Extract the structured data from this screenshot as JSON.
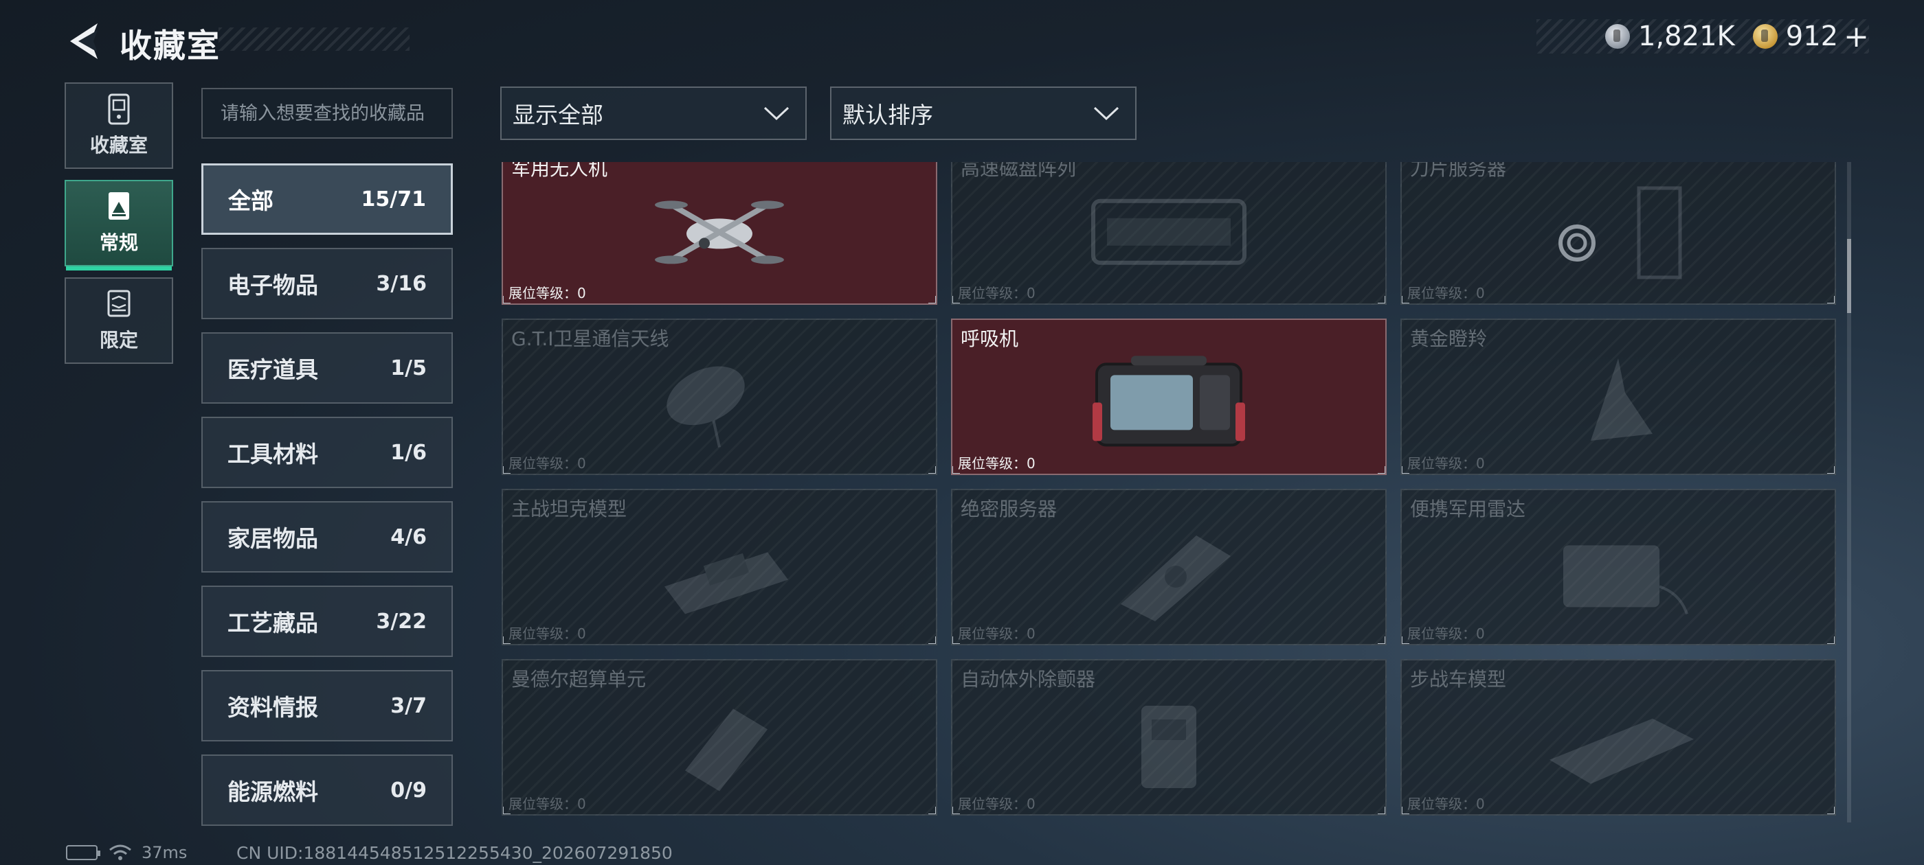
{
  "header": {
    "title": "收藏室",
    "currencies": [
      {
        "icon": "silver-coin-icon",
        "value": "1,821K"
      },
      {
        "icon": "gold-coin-icon",
        "value": "912"
      }
    ],
    "plus_label": "+"
  },
  "rail": [
    {
      "label": "收藏室",
      "icon": "cabinet-icon",
      "active": false
    },
    {
      "label": "常规",
      "icon": "image-card-icon",
      "active": true
    },
    {
      "label": "限定",
      "icon": "limited-card-icon",
      "active": false
    }
  ],
  "search": {
    "placeholder": "请输入想要查找的收藏品"
  },
  "filters": {
    "display": "显示全部",
    "sort": "默认排序"
  },
  "categories": [
    {
      "name": "全部",
      "count": "15/71",
      "active": true
    },
    {
      "name": "电子物品",
      "count": "3/16"
    },
    {
      "name": "医疗道具",
      "count": "1/5"
    },
    {
      "name": "工具材料",
      "count": "1/6"
    },
    {
      "name": "家居物品",
      "count": "4/6"
    },
    {
      "name": "工艺藏品",
      "count": "3/22"
    },
    {
      "name": "资料情报",
      "count": "3/7"
    },
    {
      "name": "能源燃料",
      "count": "0/9"
    }
  ],
  "items": [
    {
      "name": "军用无人机",
      "level": "展位等级：0",
      "owned": true,
      "icon": "drone-icon"
    },
    {
      "name": "高速磁盘阵列",
      "level": "展位等级：0",
      "owned": false,
      "icon": "disk-array-icon"
    },
    {
      "name": "刀片服务器",
      "level": "展位等级：0",
      "owned": false,
      "icon": "blade-server-icon"
    },
    {
      "name": "G.T.I卫星通信天线",
      "level": "展位等级：0",
      "owned": false,
      "icon": "satellite-dish-icon"
    },
    {
      "name": "呼吸机",
      "level": "展位等级：0",
      "owned": true,
      "icon": "ventilator-icon"
    },
    {
      "name": "黄金瞪羚",
      "level": "展位等级：0",
      "owned": false,
      "icon": "gazelle-statue-icon"
    },
    {
      "name": "主战坦克模型",
      "level": "展位等级：0",
      "owned": false,
      "icon": "tank-model-icon"
    },
    {
      "name": "绝密服务器",
      "level": "展位等级：0",
      "owned": false,
      "icon": "server-icon"
    },
    {
      "name": "便携军用雷达",
      "level": "展位等级：0",
      "owned": false,
      "icon": "radar-icon"
    },
    {
      "name": "曼德尔超算单元",
      "level": "展位等级：0",
      "owned": false,
      "icon": "supercomputer-icon"
    },
    {
      "name": "自动体外除颤器",
      "level": "展位等级：0",
      "owned": false,
      "icon": "defibrillator-icon"
    },
    {
      "name": "步战车模型",
      "level": "展位等级：0",
      "owned": false,
      "icon": "ifv-model-icon"
    }
  ],
  "footer": {
    "ping": "37ms",
    "uid": "CN UID:1881445485125122554​30_202607291850"
  }
}
